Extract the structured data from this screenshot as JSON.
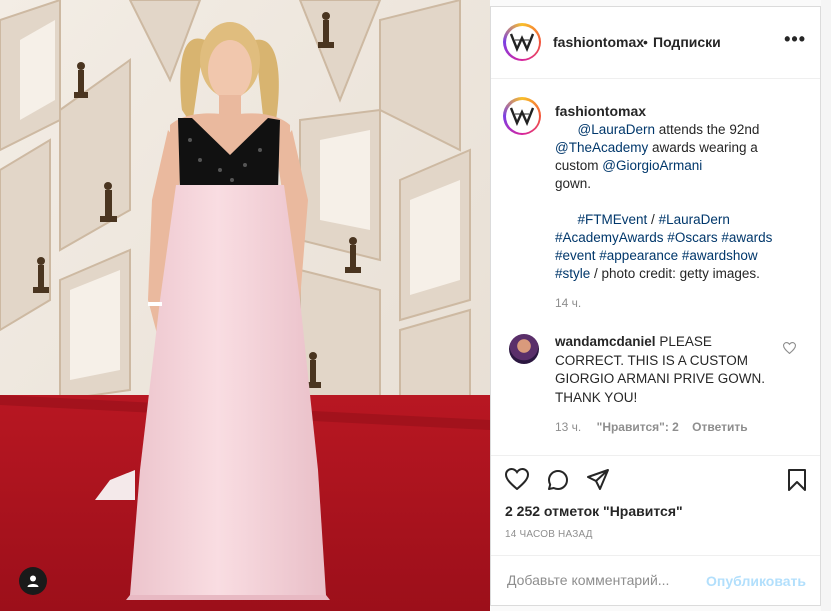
{
  "post": {
    "header": {
      "username": "fashiontomax",
      "separator": "•",
      "follow_label": "Подписки",
      "more_icon": "more-horizontal-icon"
    },
    "caption": {
      "username": "fashiontomax",
      "lines": [
        {
          "pre": "",
          "link": "@LauraDern",
          "post": " attends the 92nd"
        },
        {
          "pre": "",
          "link": "@TheAcademy",
          "post": " awards wearing a"
        },
        {
          "pre": "custom ",
          "link": "@GiorgioArmani",
          "post": ""
        },
        {
          "pre": "gown.",
          "link": "",
          "post": ""
        },
        {
          "pre": "",
          "link": "",
          "post": ""
        },
        {
          "pre": "",
          "link": "#FTMEvent",
          "post": " / "
        },
        {
          "pre": "",
          "link": "#AcademyAwards #Oscars #awards",
          "post": ""
        },
        {
          "pre": "",
          "link": "#event #appearance #awardshow",
          "post": ""
        },
        {
          "pre": "",
          "link": "#style",
          "post": " / photo credit: getty images."
        }
      ],
      "line5_link2": "#LauraDern",
      "time": "14 ч."
    },
    "comment": {
      "username": "wandamcdaniel",
      "text": "PLEASE CORRECT. THIS IS A CUSTOM GIORGIO ARMANI PRIVE GOWN. THANK YOU!",
      "time": "13 ч.",
      "likes_label": "\"Нравится\": 2",
      "reply_label": "Ответить"
    },
    "likes": "2 252 отметок \"Нравится\"",
    "posted_time": "14 ЧАСОВ НАЗАД",
    "comment_box": {
      "placeholder": "Добавьте комментарий...",
      "publish_label": "Опубликовать"
    }
  },
  "colors": {
    "link": "#00376b",
    "muted": "#8e8e8e",
    "publish_disabled": "#b2dffc",
    "carpet": "#b0141f",
    "dress": "#f6d6dc"
  }
}
